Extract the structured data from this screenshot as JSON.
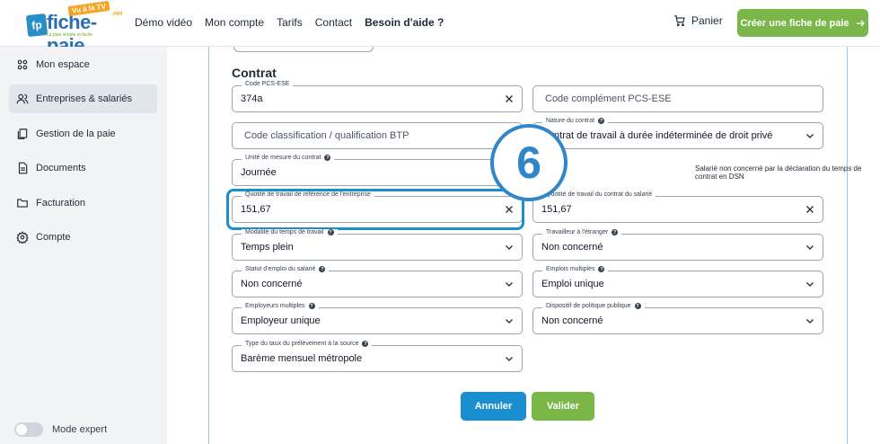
{
  "header": {
    "logo_text": "fiche-paie",
    "logo_badge": "Vu à la TV",
    "logo_suffix": ".net",
    "logo_tagline": "La paie simple et facile",
    "nav": [
      "Démo vidéo",
      "Mon compte",
      "Tarifs",
      "Contact",
      "Besoin d'aide ?"
    ],
    "cart_label": "Panier",
    "cta_label": "Créer une fiche de paie"
  },
  "sidebar": {
    "items": [
      {
        "label": "Mon espace",
        "icon": "users-icon"
      },
      {
        "label": "Entreprises & salariés",
        "icon": "people-icon"
      },
      {
        "label": "Gestion de la paie",
        "icon": "documents-icon"
      },
      {
        "label": "Documents",
        "icon": "document-icon"
      },
      {
        "label": "Facturation",
        "icon": "folder-icon"
      },
      {
        "label": "Compte",
        "icon": "gear-icon"
      }
    ],
    "mode_label": "Mode expert"
  },
  "form": {
    "section_title": "Contrat",
    "fields": {
      "code_pcs": {
        "label": "Code PCS-ESE",
        "value": "374a"
      },
      "code_complement": {
        "placeholder": "Code complément PCS-ESE"
      },
      "code_classification": {
        "placeholder": "Code classification / qualification BTP"
      },
      "nature_contrat": {
        "label": "Nature du contrat",
        "value": "Contrat de travail à durée indéterminée de droit privé"
      },
      "unite_mesure": {
        "label": "Unité de mesure du contrat",
        "value": "Journée"
      },
      "note": "Salarié non concerné par la déclaration du temps de contrat en DSN",
      "quotite_entreprise": {
        "label": "Quotité de travail de référence de l'entreprise",
        "value": "151,67"
      },
      "quotite_salarie": {
        "label": "Quotité de travail du contrat du salarié",
        "value": "151,67"
      },
      "modalite_temps": {
        "label": "Modalité du temps de travail",
        "value": "Temps plein"
      },
      "travailleur_etranger": {
        "label": "Travailleur à l'étranger",
        "value": "Non concerné"
      },
      "statut_emploi": {
        "label": "Statut d'emploi du salarié",
        "value": "Non concerné"
      },
      "emplois_multiples": {
        "label": "Emplois multiples",
        "value": "Emploi unique"
      },
      "employeurs_multiples": {
        "label": "Employeurs multiples",
        "value": "Employeur unique"
      },
      "dispositif_politique": {
        "label": "Dispositif de politique publique",
        "value": "Non concerné"
      },
      "type_taux": {
        "label": "Type du taux du prélèvement à la source",
        "value": "Barème mensuel métropole"
      }
    },
    "step_badge": "6",
    "cancel_label": "Annuler",
    "submit_label": "Valider"
  }
}
